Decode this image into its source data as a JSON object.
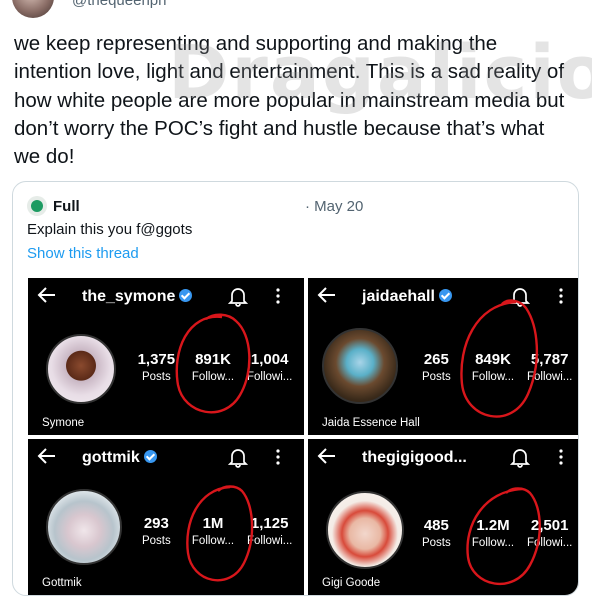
{
  "header": {
    "handle": "@thequeenph"
  },
  "tweet": {
    "text": "we keep representing and supporting and making the intention love, light and entertainment. This is a sad reality of how white people are more popular in mainstream media but don’t worry the POC’s fight and hustle because that’s what we do!",
    "watermark": "Dragalicious"
  },
  "quote": {
    "name": "Full",
    "date": "· May 20",
    "text": "Explain this you f@ggots",
    "thread_link": "Show this thread"
  },
  "profiles": [
    {
      "username": "the_symone",
      "verified": true,
      "posts": "1,375",
      "followers": "891K",
      "following": "1,004",
      "display_name": "Symone",
      "posts_label": "Posts",
      "followers_label": "Follow...",
      "following_label": "Followi..."
    },
    {
      "username": "jaidaehall",
      "verified": true,
      "posts": "265",
      "followers": "849K",
      "following": "5,787",
      "display_name": "Jaida Essence Hall",
      "posts_label": "Posts",
      "followers_label": "Follow...",
      "following_label": "Followi..."
    },
    {
      "username": "gottmik",
      "verified": true,
      "posts": "293",
      "followers": "1M",
      "following": "1,125",
      "display_name": "Gottmik",
      "posts_label": "Posts",
      "followers_label": "Follow...",
      "following_label": "Followi..."
    },
    {
      "username": "thegigigood...",
      "verified": false,
      "posts": "485",
      "followers": "1.2M",
      "following": "2,501",
      "display_name": "Gigi Goode",
      "posts_label": "Posts",
      "followers_label": "Follow...",
      "following_label": "Followi..."
    }
  ],
  "colors": {
    "link": "#1d9bf0",
    "verified": "#3897f0",
    "annotation": "#d8161b",
    "panel_bg": "#000000"
  },
  "icons": [
    "back-arrow-icon",
    "verified-badge-icon",
    "bell-icon",
    "more-vertical-icon"
  ]
}
